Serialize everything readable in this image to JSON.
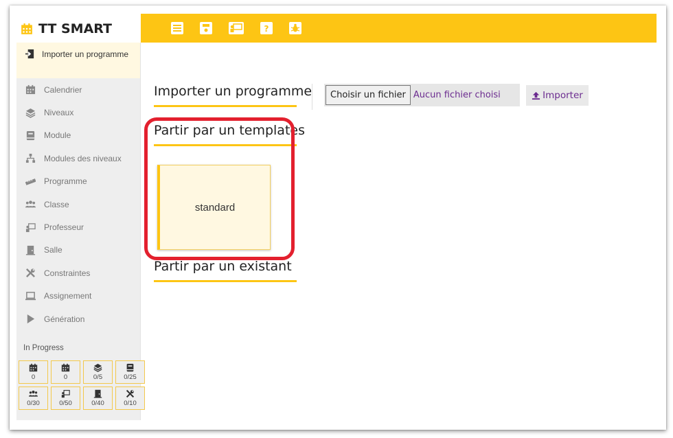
{
  "app": {
    "title": "TT SMART"
  },
  "toolbar": {
    "buttons": [
      {
        "name": "menu-button",
        "icon": "menu-icon"
      },
      {
        "name": "save-button",
        "icon": "save-icon"
      },
      {
        "name": "teacher-button",
        "icon": "presentation-icon"
      },
      {
        "name": "help-button",
        "icon": "help-icon"
      },
      {
        "name": "bug-button",
        "icon": "bug-icon"
      }
    ],
    "help_label": "?"
  },
  "sidebar": {
    "active": {
      "label": "Importer un programme",
      "icon": "import-icon"
    },
    "items": [
      {
        "label": "Calendrier",
        "icon": "calendar-icon"
      },
      {
        "label": "Niveaux",
        "icon": "layers-icon"
      },
      {
        "label": "Module",
        "icon": "book-icon"
      },
      {
        "label": "Modules des niveaux",
        "icon": "sitemap-icon"
      },
      {
        "label": "Programme",
        "icon": "ruler-icon"
      },
      {
        "label": "Classe",
        "icon": "users-icon"
      },
      {
        "label": "Professeur",
        "icon": "presentation-icon"
      },
      {
        "label": "Salle",
        "icon": "door-icon"
      },
      {
        "label": "Constraintes",
        "icon": "tools-icon"
      },
      {
        "label": "Assignement",
        "icon": "laptop-icon"
      },
      {
        "label": "Génération",
        "icon": "play-icon"
      }
    ],
    "progress_title": "In Progress",
    "stats": [
      {
        "icon": "calendar-icon",
        "value": "0"
      },
      {
        "icon": "calendar-icon",
        "value": "0"
      },
      {
        "icon": "layers-icon",
        "value": "0/5"
      },
      {
        "icon": "book-icon",
        "value": "0/25"
      },
      {
        "icon": "users-icon",
        "value": "0/30"
      },
      {
        "icon": "presentation-icon",
        "value": "0/50"
      },
      {
        "icon": "door-icon",
        "value": "0/40"
      },
      {
        "icon": "tools-icon",
        "value": "0/10"
      }
    ]
  },
  "main": {
    "import_title": "Importer un programme",
    "file_button": "Choisir un fichier",
    "file_status": "Aucun fichier choisi",
    "import_button": "Importer",
    "templates_title": "Partir par un templates",
    "template_card": "standard",
    "existing_title": "Partir par un existant"
  },
  "colors": {
    "accent": "#fdc514",
    "link": "#6b2b8f",
    "highlight": "#e3202e",
    "card_bg": "#fff8e1"
  }
}
